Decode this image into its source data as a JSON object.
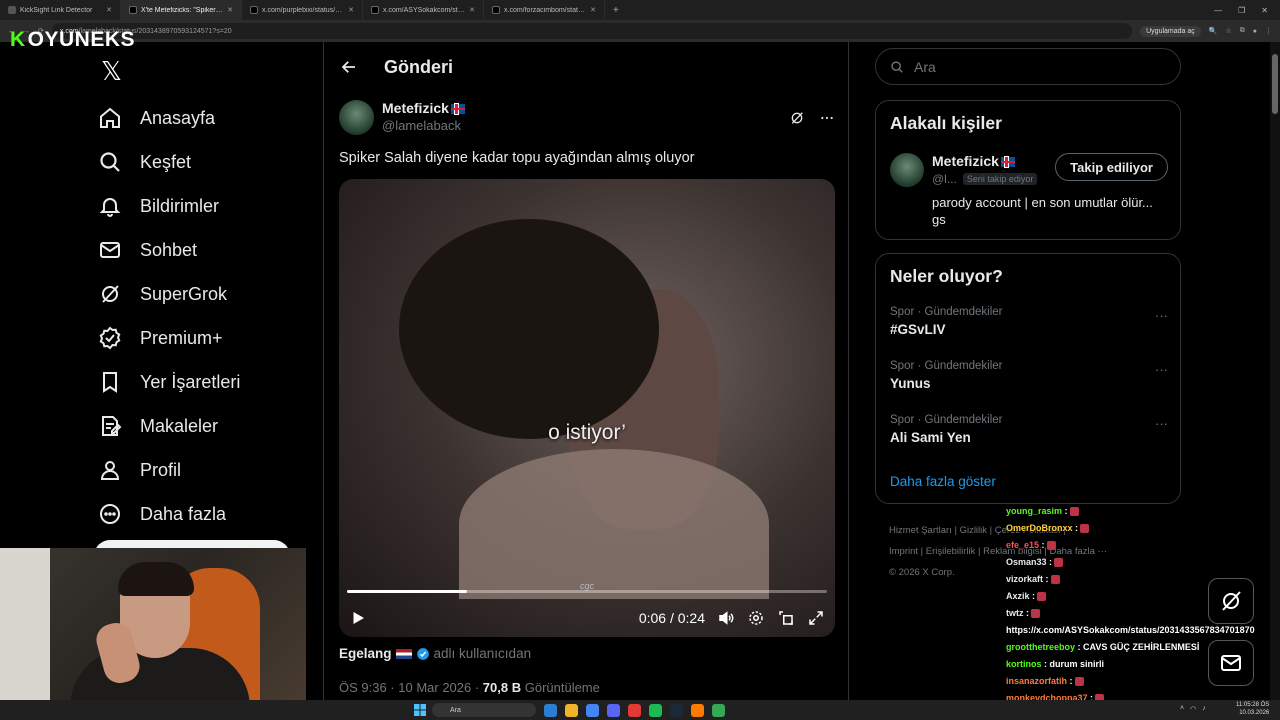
{
  "browser": {
    "tabs": [
      {
        "title": "KickSight Link Detector",
        "active": false
      },
      {
        "title": "X'te Metefizicks: \"Spiker Salah",
        "active": true
      },
      {
        "title": "x.com/purplebixi/status/20314",
        "active": false
      },
      {
        "title": "x.com/ASYSokakcom/status/20",
        "active": false
      },
      {
        "title": "x.com/forzacimbom/status/20",
        "active": false
      }
    ],
    "new_tab": "+",
    "url_domain": "x.com",
    "url_path": "/lamelaback/status/2031438970593124571?s=20",
    "app_button": "Uygulamada aç"
  },
  "overlay": {
    "brand_k": "K",
    "brand_rest": "OYUNEKS"
  },
  "x_logo": "𝕏",
  "nav": [
    {
      "label": "Anasayfa",
      "icon": "home-icon"
    },
    {
      "label": "Keşfet",
      "icon": "search-icon"
    },
    {
      "label": "Bildirimler",
      "icon": "bell-icon"
    },
    {
      "label": "Sohbet",
      "icon": "mail-icon"
    },
    {
      "label": "SuperGrok",
      "icon": "grok-icon"
    },
    {
      "label": "Premium+",
      "icon": "verified-icon"
    },
    {
      "label": "Yer İşaretleri",
      "icon": "bookmark-icon"
    },
    {
      "label": "Makaleler",
      "icon": "article-icon"
    },
    {
      "label": "Profil",
      "icon": "person-icon"
    },
    {
      "label": "Daha fazla",
      "icon": "more-circle-icon"
    }
  ],
  "main": {
    "header_title": "Gönderi",
    "author_name": "Metefizick",
    "author_handle": "@lamelaback",
    "post_text": "Spiker Salah diyene kadar topu ayağından almış oluyor",
    "video": {
      "caption": "o istiyor’",
      "watermark": "cgc",
      "current_time": "0:06",
      "duration": "0:24",
      "time_separator": "/",
      "progress": 0.25
    },
    "credit_name": "Egelang",
    "credit_suffix": "adlı kullanıcıdan",
    "meta_time": "ÖS 9:36 · 10 Mar 2026 · ",
    "meta_views": "70,8 B",
    "meta_views_label": " Görüntüleme"
  },
  "right": {
    "search_placeholder": "Ara",
    "related_title": "Alakalı kişiler",
    "related": {
      "name": "Metefizick",
      "handle": "@l...",
      "badge": "Seni takip ediyor",
      "button": "Takip ediliyor",
      "bio_line1": "parody account | en son umutlar ölür...",
      "bio_line2": "gs"
    },
    "trends_title": "Neler oluyor?",
    "trends": [
      {
        "category": "Spor · Gündemdekiler",
        "name": "#GSvLIV"
      },
      {
        "category": "Spor · Gündemdekiler",
        "name": "Yunus"
      },
      {
        "category": "Spor · Gündemdekiler",
        "name": "Ali Sami Yen"
      }
    ],
    "trend_more": "···",
    "show_more": "Daha fazla göster",
    "footer": {
      "line1": "Hizmet Şartları  |  Gizlilik  |  Çerez Politikası  |",
      "line2": "Imprint  |  Erişilebilirlik  |  Reklam bilgisi  |  Daha fazla ···",
      "line3": "© 2026 X Corp."
    }
  },
  "chat": [
    {
      "user": "young_rasim",
      "color": "#53fc18",
      "text": ":"
    },
    {
      "user": "OmerDoBronxx",
      "color": "#ffd23f",
      "text": ":"
    },
    {
      "user": "efe_e15",
      "color": "#ff4e4e",
      "text": ":"
    },
    {
      "user": "Osman33",
      "color": "#e7e9ea",
      "text": ":"
    },
    {
      "user": "vizorkaft",
      "color": "#e7e9ea",
      "text": ":"
    },
    {
      "user": "Axzik",
      "color": "#e7e9ea",
      "text": ":"
    },
    {
      "user": "twtz",
      "color": "#e7e9ea",
      "text": ":"
    },
    {
      "user": "",
      "color": "#e7e9ea",
      "text": "https://x.com/ASYSokakcom/status/2031433567834701870"
    },
    {
      "user": "grootthetreeboy",
      "color": "#53fc18",
      "text": ": CAVS GÜÇ ZEHİRLENMESİ"
    },
    {
      "user": "kortinos",
      "color": "#53fc18",
      "text": ": durum sinirli"
    },
    {
      "user": "insanazorfatih",
      "color": "#ff7a3d",
      "text": ":"
    },
    {
      "user": "monkeydchoppa37",
      "color": "#ff7a3d",
      "text": ":"
    }
  ],
  "taskbar": {
    "search": "Ara",
    "time": "11:05:28 ÖS",
    "date": "10.03.2026"
  }
}
